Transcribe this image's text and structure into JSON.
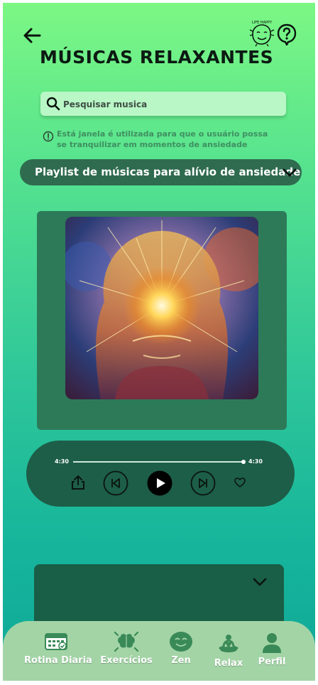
{
  "header": {
    "title": "MÚSICAS RELAXANTES",
    "back_icon": "arrow-left-icon",
    "mascot_icon": "smiling-character-icon",
    "mascot_caption": "LIFE HAPPY",
    "help_icon": "question-circle-icon"
  },
  "search": {
    "placeholder": "Pesquisar musica",
    "value": "",
    "icon": "search-icon"
  },
  "info": {
    "icon": "info-circle-icon",
    "text": "Está janela é utilizada para que o usuário possa se tranquilizar em momentos de ansiedade"
  },
  "playlist": {
    "selected": "Playlist de músicas para alívio de ansiedade",
    "icon": "chevron-down-icon"
  },
  "player": {
    "current_time": "4:30",
    "total_time": "4:30",
    "progress": 1.0,
    "controls": [
      "share-icon",
      "previous-icon",
      "play-icon",
      "next-icon",
      "heart-icon"
    ]
  },
  "nav": {
    "items": [
      {
        "label": "Rotina Diaria",
        "icon": "calendar-icon"
      },
      {
        "label": "Exercícios",
        "icon": "brain-icon"
      },
      {
        "label": "Zen",
        "icon": "smile-face-icon"
      },
      {
        "label": "Relax",
        "icon": "meditation-icon"
      },
      {
        "label": "Perfil",
        "icon": "person-icon"
      }
    ]
  },
  "colors": {
    "background_top": "#7cf784",
    "background_bottom": "#10a89a",
    "card": "#2d7a59",
    "player": "#1d5e48",
    "nav": "#a3d4a6"
  }
}
